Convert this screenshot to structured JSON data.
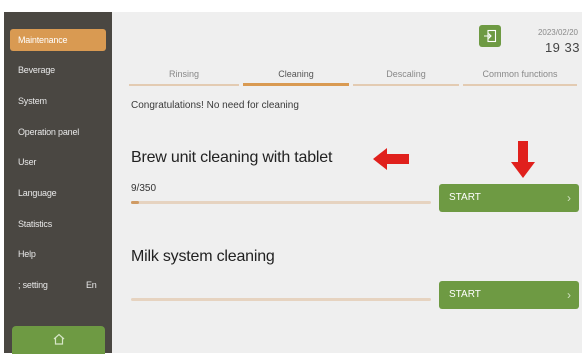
{
  "sidebar": {
    "items": [
      {
        "label": "Maintenance",
        "active": true
      },
      {
        "label": "Beverage"
      },
      {
        "label": "System"
      },
      {
        "label": "Operation panel"
      },
      {
        "label": "User"
      },
      {
        "label": "Language"
      },
      {
        "label": "Statistics"
      },
      {
        "label": "Help"
      },
      {
        "label": "; setting",
        "tag": "En"
      }
    ],
    "home_icon": "home-icon"
  },
  "header": {
    "exit_icon": "exit-icon",
    "date": "2023/02/20",
    "time": "19 33"
  },
  "tabs": [
    {
      "label": "Rinsing"
    },
    {
      "label": "Cleaning",
      "active": true
    },
    {
      "label": "Descaling"
    },
    {
      "label": "Common functions"
    }
  ],
  "main": {
    "notice": "Congratulations! No need for cleaning",
    "brew": {
      "title": "Brew unit cleaning with tablet",
      "counter": "9/350",
      "progress": 0.026,
      "button_label": "START"
    },
    "milk": {
      "title": "Milk system cleaning",
      "progress": 0,
      "button_label": "START"
    }
  },
  "colors": {
    "accent": "#d99a52",
    "button_green": "#6e9a43",
    "sidebar_bg": "#4a4742",
    "annotation_red": "#e0201c"
  }
}
